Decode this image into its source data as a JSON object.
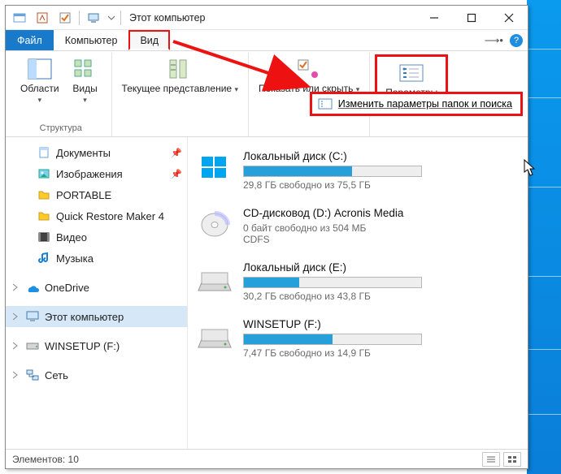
{
  "title": "Этот компьютер",
  "tabs": {
    "file": "Файл",
    "computer": "Компьютер",
    "view": "Вид"
  },
  "ribbon": {
    "areas": "Области",
    "views": "Виды",
    "structure": "Структура",
    "current_view": "Текущее представление",
    "show_hide": "Показать или скрыть",
    "params": "Параметры"
  },
  "dropdown": {
    "change_params": "Изменить параметры папок и поиска"
  },
  "nav": {
    "documents": "Документы",
    "images": "Изображения",
    "portable": "PORTABLE",
    "qrm": "Quick Restore Maker 4",
    "video": "Видео",
    "music": "Музыка",
    "onedrive": "OneDrive",
    "thispc": "Этот компьютер",
    "winsetup": "WINSETUP (F:)",
    "network": "Сеть"
  },
  "drives": [
    {
      "name": "Локальный диск (C:)",
      "stat": "29,8 ГБ свободно из 75,5 ГБ",
      "pct": 61,
      "type": "hdd"
    },
    {
      "name": "CD-дисковод (D:) Acronis Media",
      "stat": "0 байт свободно из 504 МБ",
      "sub": "CDFS",
      "type": "cd"
    },
    {
      "name": "Локальный диск (E:)",
      "stat": "30,2 ГБ свободно из 43,8 ГБ",
      "pct": 31,
      "type": "hdd"
    },
    {
      "name": "WINSETUP (F:)",
      "stat": "7,47 ГБ свободно из 14,9 ГБ",
      "pct": 50,
      "type": "hdd"
    }
  ],
  "status": {
    "elements_label": "Элементов:",
    "count": "10"
  }
}
